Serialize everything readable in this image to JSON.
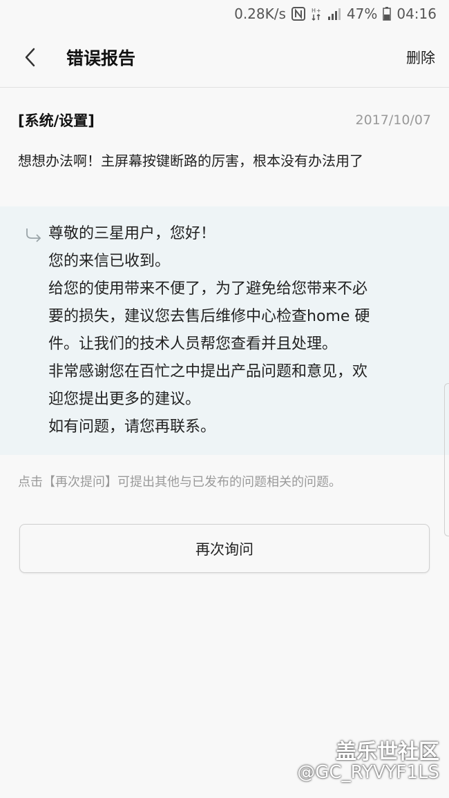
{
  "status_bar": {
    "network_speed": "0.28K/s",
    "nfc_icon": "N",
    "battery_percent": "47%",
    "time": "04:16"
  },
  "app_bar": {
    "title": "错误报告",
    "delete_label": "删除"
  },
  "question": {
    "category": "[系统/设置]",
    "date": "2017/10/07",
    "body": "想想办法啊！主屏幕按键断路的厉害，根本没有办法用了"
  },
  "answer": {
    "lines": [
      "尊敬的三星用户，您好！",
      "您的来信已收到。",
      "给您的使用带来不便了，为了避免给您带来不必",
      "要的损失，建议您去售后维修中心检查home 硬",
      "件。让我们的技术人员帮您查看并且处理。",
      "非常感谢您在百忙之中提出产品问题和意见，欢",
      "迎您提出更多的建议。",
      "如有问题，请您再联系。"
    ]
  },
  "hint": "点击【再次提问】可提出其他与已发布的问题相关的问题。",
  "ask_again_label": "再次询问",
  "watermark": {
    "logo": "盖乐世社区",
    "user": "@GC_RYVYF1LS"
  },
  "icons": {
    "back": "chevron-left-icon",
    "reply": "reply-arrow-icon",
    "nfc": "nfc-icon",
    "signal": "signal-icon",
    "battery": "battery-icon"
  },
  "colors": {
    "background": "#f8f8f8",
    "answer_background": "#eef4f6",
    "muted_text": "#999999"
  }
}
